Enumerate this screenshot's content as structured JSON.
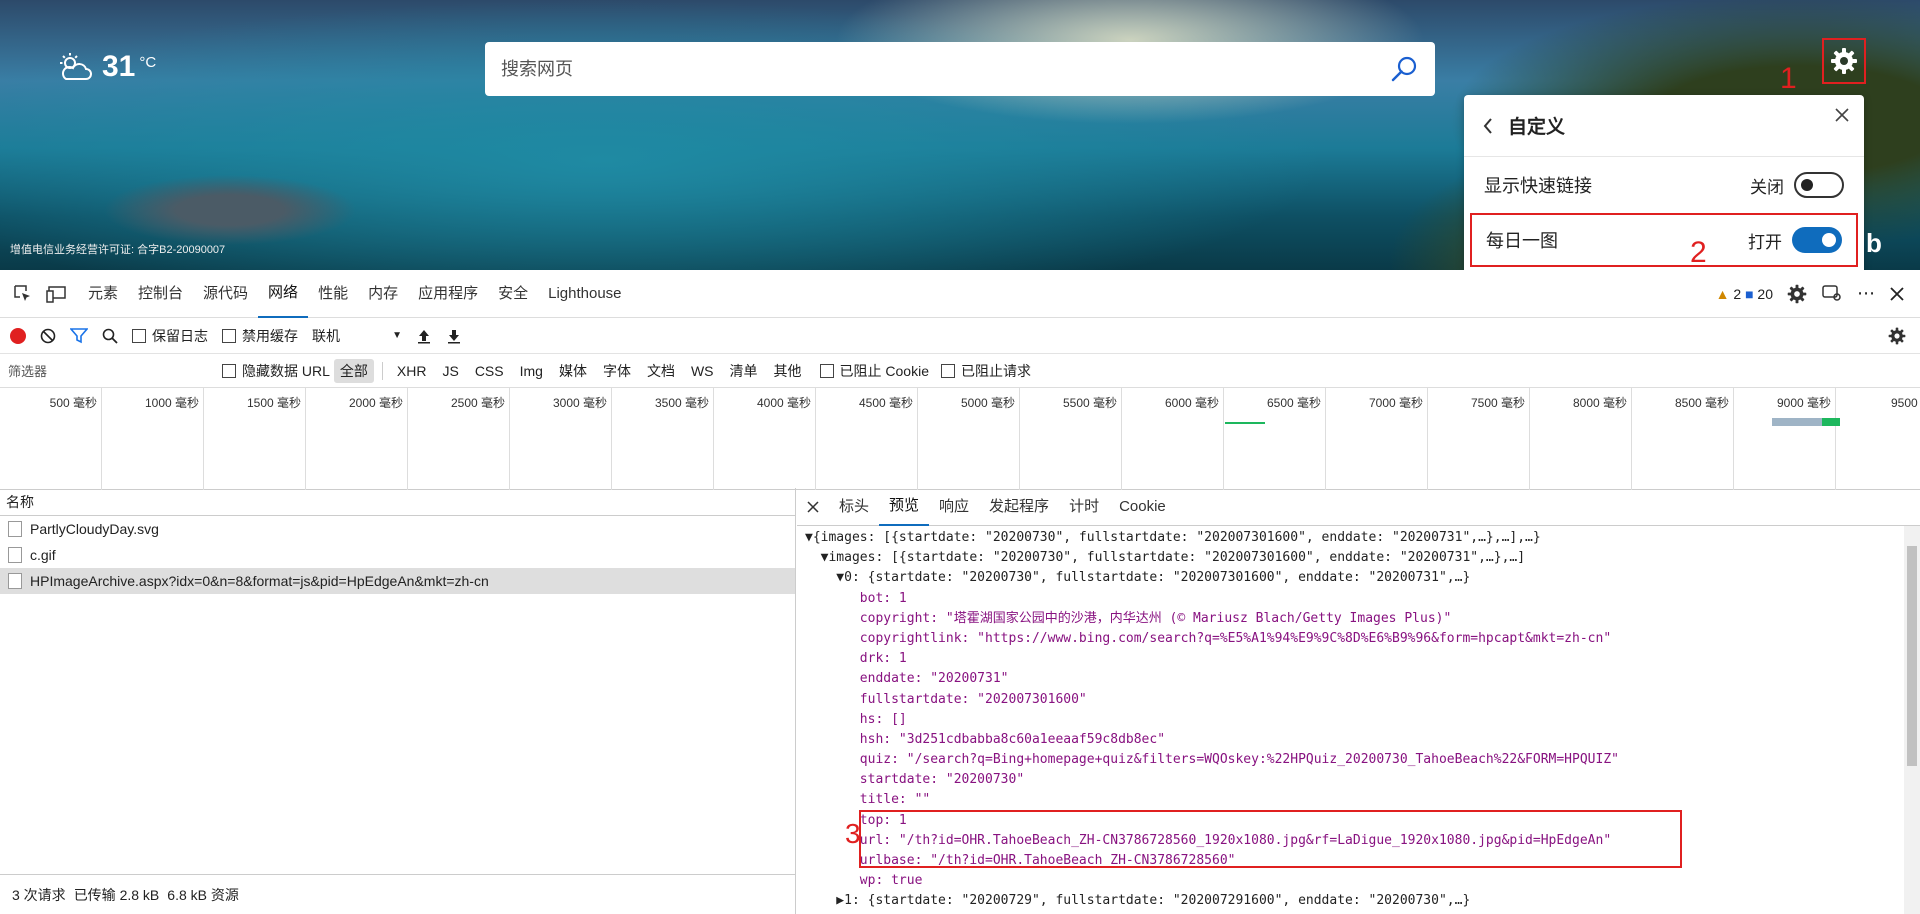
{
  "weather": {
    "temp": "31",
    "unit": "°C"
  },
  "license": "增值电信业务经营许可证: 合字B2-20090007",
  "search": {
    "placeholder": "搜索网页"
  },
  "annotations": {
    "n1": "1",
    "n2": "2",
    "n3": "3"
  },
  "customize": {
    "title": "自定义",
    "rows": [
      {
        "label": "显示快速链接",
        "state": "关闭",
        "on": false
      },
      {
        "label": "每日一图",
        "state": "打开",
        "on": true
      }
    ]
  },
  "devtools": {
    "tabs": [
      "元素",
      "控制台",
      "源代码",
      "网络",
      "性能",
      "内存",
      "应用程序",
      "安全",
      "Lighthouse"
    ],
    "active_tab": "网络",
    "warnings": "2",
    "messages": "20",
    "toolbar": {
      "preserve_log": "保留日志",
      "disable_cache": "禁用缓存",
      "throttle": "联机"
    },
    "filter": {
      "placeholder": "筛选器",
      "hide_data_url": "隐藏数据 URL",
      "types": [
        "全部",
        "XHR",
        "JS",
        "CSS",
        "Img",
        "媒体",
        "字体",
        "文档",
        "WS",
        "清单",
        "其他"
      ],
      "selected_type": "全部",
      "blocked_cookies": "已阻止 Cookie",
      "blocked_requests": "已阻止请求"
    },
    "timeline_ticks": [
      "500 毫秒",
      "1000 毫秒",
      "1500 毫秒",
      "2000 毫秒",
      "2500 毫秒",
      "3000 毫秒",
      "3500 毫秒",
      "4000 毫秒",
      "4500 毫秒",
      "5000 毫秒",
      "5500 毫秒",
      "6000 毫秒",
      "6500 毫秒",
      "7000 毫秒",
      "7500 毫秒",
      "8000 毫秒",
      "8500 毫秒",
      "9000 毫秒",
      "9500 毫"
    ],
    "requests_header": "名称",
    "requests": [
      {
        "name": "PartlyCloudyDay.svg"
      },
      {
        "name": "c.gif"
      },
      {
        "name": "HPImageArchive.aspx?idx=0&n=8&format=js&pid=HpEdgeAn&mkt=zh-cn"
      }
    ],
    "status": {
      "requests": "3 次请求",
      "transferred": "已传输 2.8 kB",
      "resources": "6.8 kB 资源"
    },
    "detail_tabs": [
      "标头",
      "预览",
      "响应",
      "发起程序",
      "计时",
      "Cookie"
    ],
    "active_detail_tab": "预览",
    "preview_lines": [
      "▼{images: [{startdate: \"20200730\", fullstartdate: \"202007301600\", enddate: \"20200731\",…},…],…}",
      "  ▼images: [{startdate: \"20200730\", fullstartdate: \"202007301600\", enddate: \"20200731\",…},…]",
      "    ▼0: {startdate: \"20200730\", fullstartdate: \"202007301600\", enddate: \"20200731\",…}",
      "       bot: 1",
      "       copyright: \"塔霍湖国家公园中的沙港，内华达州 (© Mariusz Blach/Getty Images Plus)\"",
      "       copyrightlink: \"https://www.bing.com/search?q=%E5%A1%94%E9%9C%8D%E6%B9%96&form=hpcapt&mkt=zh-cn\"",
      "       drk: 1",
      "       enddate: \"20200731\"",
      "       fullstartdate: \"202007301600\"",
      "       hs: []",
      "       hsh: \"3d251cdbabba8c60a1eeaaf59c8db8ec\"",
      "       quiz: \"/search?q=Bing+homepage+quiz&filters=WQOskey:%22HPQuiz_20200730_TahoeBeach%22&FORM=HPQUIZ\"",
      "       startdate: \"20200730\"",
      "       title: \"\"",
      "       top: 1",
      "       url: \"/th?id=OHR.TahoeBeach_ZH-CN3786728560_1920x1080.jpg&rf=LaDigue_1920x1080.jpg&pid=HpEdgeAn\"",
      "       urlbase: \"/th?id=OHR.TahoeBeach_ZH-CN3786728560\"",
      "       wp: true",
      "    ▶1: {startdate: \"20200729\", fullstartdate: \"202007291600\", enddate: \"20200730\",…}"
    ]
  }
}
